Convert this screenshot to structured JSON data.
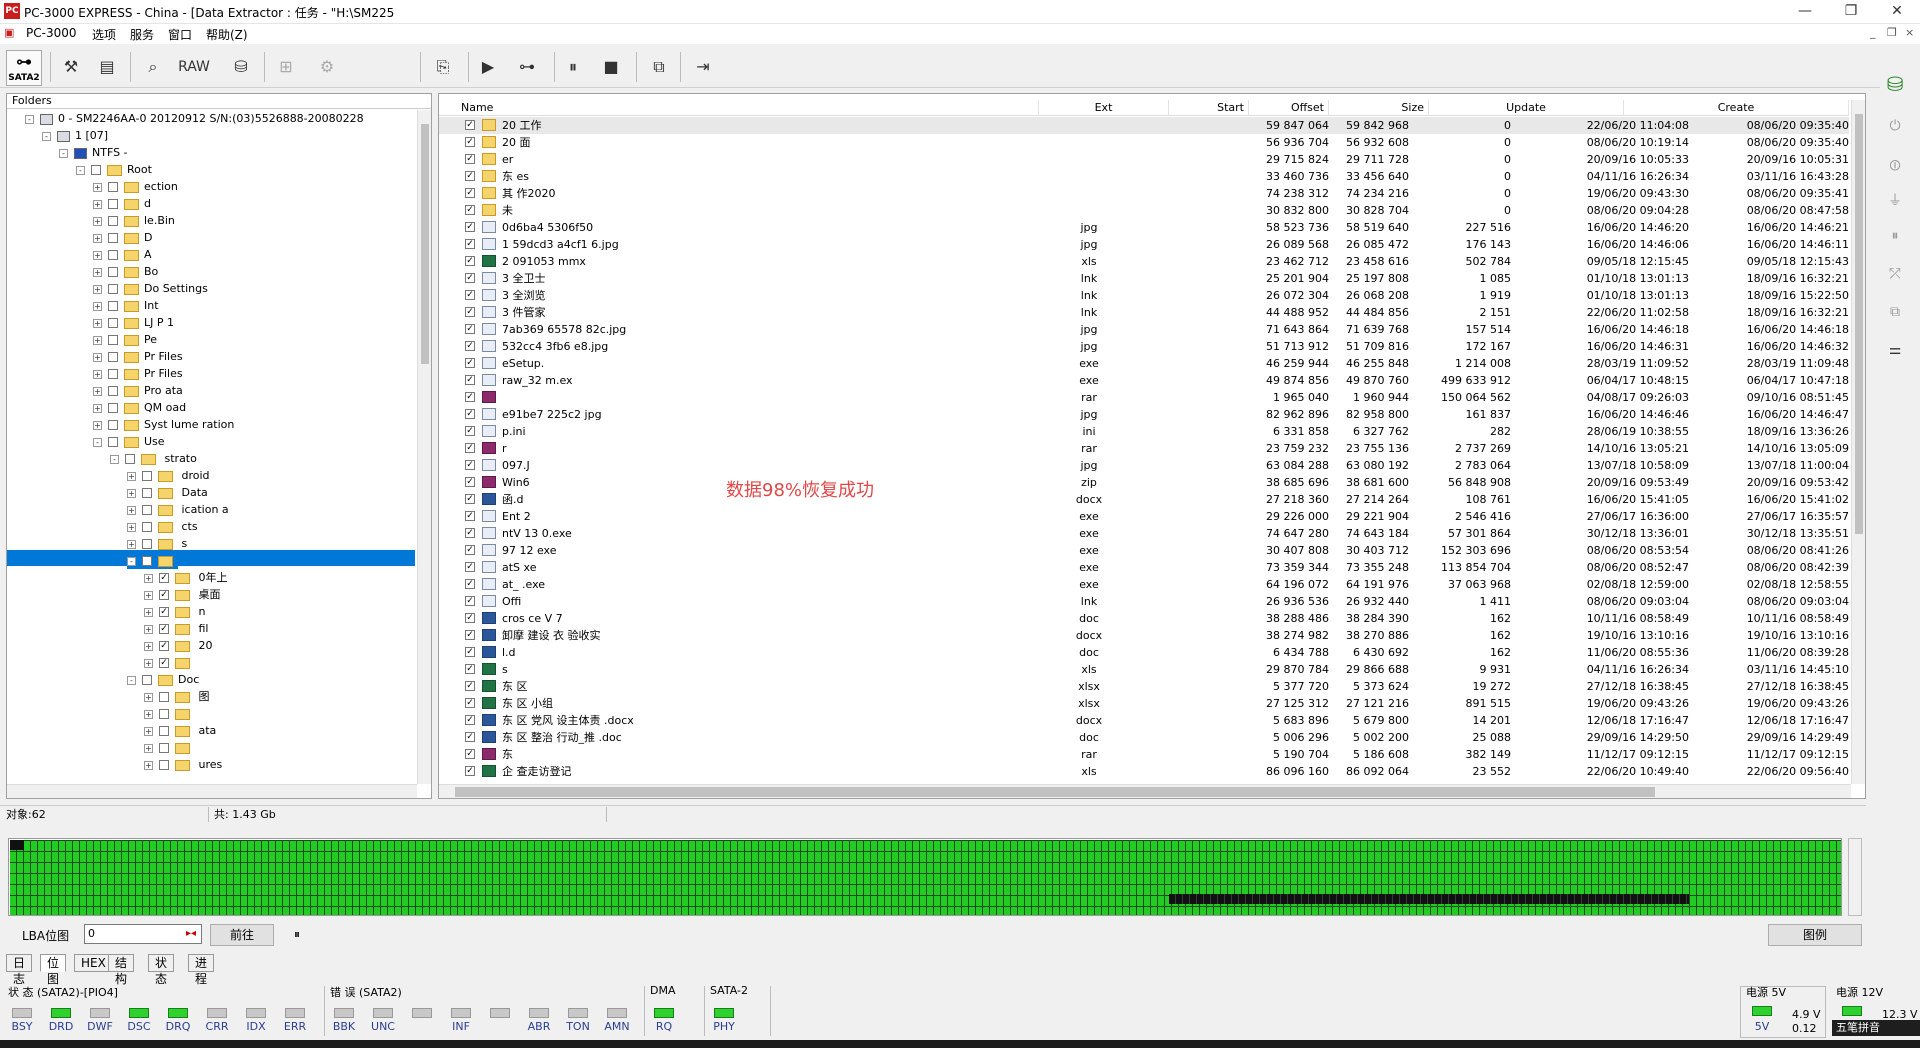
{
  "window": {
    "app_badge": "PC",
    "title": "PC-3000 EXPRESS - China - [Data Extractor : 任务 - \"H:\\SM225",
    "minimize": "—",
    "maximize": "❐",
    "close": "✕"
  },
  "menu": {
    "items": [
      "PC-3000",
      "选项",
      "服务",
      "窗口",
      "帮助(Z)"
    ],
    "mdi_min": "_",
    "mdi_restore": "❐",
    "mdi_close": "×"
  },
  "toolbar": {
    "sata_label": "SATA2",
    "sata_glyph": "⊶",
    "raw_label": "RAW",
    "tools_glyph": "⚒",
    "doc_glyph": "▤",
    "binoc_glyph": "⌕",
    "disk_glyph": "⛁",
    "grid_glyph": "⊞",
    "gears_glyph": "⚙",
    "export_glyph": "⎘",
    "play_glyph": "▶",
    "tree_glyph": "⊶",
    "pause_glyph": "⏸",
    "stop_glyph": "■",
    "copy_glyph": "⧉",
    "run_glyph": "⇥"
  },
  "tree": {
    "header": "Folders",
    "nodes": [
      {
        "label": "0 - SM2246AA-0 20120912 S/N:(03)5526888-20080228",
        "level": 0,
        "exp": "-",
        "check": ""
      },
      {
        "label": "1 [07]",
        "level": 1,
        "exp": "-",
        "check": ""
      },
      {
        "label": "NTFS -",
        "level": 2,
        "exp": "-",
        "check": ""
      },
      {
        "label": "Root",
        "level": 3,
        "exp": "-",
        "check": ""
      },
      {
        "label": "ection",
        "level": 4,
        "exp": "+",
        "check": ""
      },
      {
        "label": "d",
        "level": 4,
        "exp": "+",
        "check": ""
      },
      {
        "label": "le.Bin",
        "level": 4,
        "exp": "+",
        "check": ""
      },
      {
        "label": "D",
        "level": 4,
        "exp": "+",
        "check": ""
      },
      {
        "label": "A",
        "level": 4,
        "exp": "+",
        "check": ""
      },
      {
        "label": "Bo",
        "level": 4,
        "exp": "+",
        "check": ""
      },
      {
        "label": "Do          Settings",
        "level": 4,
        "exp": "+",
        "check": ""
      },
      {
        "label": "Int",
        "level": 4,
        "exp": "+",
        "check": ""
      },
      {
        "label": "LJ     P        1",
        "level": 4,
        "exp": "+",
        "check": ""
      },
      {
        "label": "Pe",
        "level": 4,
        "exp": "+",
        "check": ""
      },
      {
        "label": "Pr       Files",
        "level": 4,
        "exp": "+",
        "check": ""
      },
      {
        "label": "Pr       Files",
        "level": 4,
        "exp": "+",
        "check": ""
      },
      {
        "label": "Pro      ata",
        "level": 4,
        "exp": "+",
        "check": ""
      },
      {
        "label": "QM       oad",
        "level": 4,
        "exp": "+",
        "check": ""
      },
      {
        "label": "Syst     lume          ration",
        "level": 4,
        "exp": "+",
        "check": ""
      },
      {
        "label": "Use",
        "level": 4,
        "exp": "-",
        "check": ""
      },
      {
        "label": "           strato",
        "level": 5,
        "exp": "-",
        "check": ""
      },
      {
        "label": "     droid",
        "level": 6,
        "exp": "+",
        "check": ""
      },
      {
        "label": "     Data",
        "level": 6,
        "exp": "+",
        "check": ""
      },
      {
        "label": "     ication       a",
        "level": 6,
        "exp": "+",
        "check": ""
      },
      {
        "label": "     cts",
        "level": 6,
        "exp": "+",
        "check": ""
      },
      {
        "label": "     s",
        "level": 6,
        "exp": "+",
        "check": ""
      },
      {
        "label": "",
        "level": 6,
        "exp": "-",
        "check": "✓",
        "selected": true
      },
      {
        "label": "         0年上",
        "level": 7,
        "exp": "+",
        "check": "✓"
      },
      {
        "label": "          桌面",
        "level": 7,
        "exp": "+",
        "check": "✓"
      },
      {
        "label": "          n",
        "level": 7,
        "exp": "+",
        "check": "✓"
      },
      {
        "label": "          fil",
        "level": 7,
        "exp": "+",
        "check": "✓"
      },
      {
        "label": "                 20",
        "level": 7,
        "exp": "+",
        "check": "✓"
      },
      {
        "label": "",
        "level": 7,
        "exp": "+",
        "check": "✓"
      },
      {
        "label": "Doc",
        "level": 6,
        "exp": "-",
        "check": ""
      },
      {
        "label": "                  图",
        "level": 7,
        "exp": "+",
        "check": ""
      },
      {
        "label": "",
        "level": 7,
        "exp": "+",
        "check": ""
      },
      {
        "label": "                  ata",
        "level": 7,
        "exp": "+",
        "check": ""
      },
      {
        "label": "",
        "level": 7,
        "exp": "+",
        "check": ""
      },
      {
        "label": "               ures",
        "level": 7,
        "exp": "+",
        "check": ""
      }
    ]
  },
  "list": {
    "columns": [
      "Name",
      "Ext",
      "Start",
      "Offset",
      "Size",
      "Update",
      "Create"
    ],
    "rows": [
      {
        "icon": "folder",
        "name": "20       工作",
        "ext": "",
        "start": "59 847 064",
        "offset": "59 842 968",
        "size": "0",
        "update": "22/06/20 11:04:08",
        "create": "08/06/20 09:35:40"
      },
      {
        "icon": "folder",
        "name": "20       面",
        "ext": "",
        "start": "56 936 704",
        "offset": "56 932 608",
        "size": "0",
        "update": "08/06/20 10:19:14",
        "create": "08/06/20 09:35:40"
      },
      {
        "icon": "folder",
        "name": "er",
        "ext": "",
        "start": "29 715 824",
        "offset": "29 711 728",
        "size": "0",
        "update": "20/09/16 10:05:33",
        "create": "20/09/16 10:05:31"
      },
      {
        "icon": "folder",
        "name": "东      es",
        "ext": "",
        "start": "33 460 736",
        "offset": "33 456 640",
        "size": "0",
        "update": "04/11/16 16:26:34",
        "create": "03/11/16 16:43:28"
      },
      {
        "icon": "folder",
        "name": "其      作2020",
        "ext": "",
        "start": "74 238 312",
        "offset": "74 234 216",
        "size": "0",
        "update": "19/06/20 09:43:30",
        "create": "08/06/20 09:35:41"
      },
      {
        "icon": "folder",
        "name": "未",
        "ext": "",
        "start": "30 832 800",
        "offset": "30 828 704",
        "size": "0",
        "update": "08/06/20 09:04:28",
        "create": "08/06/20 08:47:58"
      },
      {
        "icon": "file",
        "name": "       0d6ba4          5306f50",
        "ext": "jpg",
        "start": "58 523 736",
        "offset": "58 519 640",
        "size": "227 516",
        "update": "16/06/20 14:46:20",
        "create": "16/06/20 14:46:21"
      },
      {
        "icon": "file",
        "name": "1      59dcd3       a4cf1         6.jpg",
        "ext": "jpg",
        "start": "26 089 568",
        "offset": "26 085 472",
        "size": "176 143",
        "update": "16/06/20 14:46:06",
        "create": "16/06/20 14:46:11"
      },
      {
        "icon": "xls",
        "name": "2      091053         mmx",
        "ext": "xls",
        "start": "23 462 712",
        "offset": "23 458 616",
        "size": "502 784",
        "update": "09/05/18 12:15:45",
        "create": "09/05/18 12:15:43"
      },
      {
        "icon": "file",
        "name": "3      全卫士",
        "ext": "lnk",
        "start": "25 201 904",
        "offset": "25 197 808",
        "size": "1 085",
        "update": "01/10/18 13:01:13",
        "create": "18/09/16 16:32:21"
      },
      {
        "icon": "file",
        "name": "3      全浏览",
        "ext": "lnk",
        "start": "26 072 304",
        "offset": "26 068 208",
        "size": "1 919",
        "update": "01/10/18 13:01:13",
        "create": "18/09/16 15:22:50"
      },
      {
        "icon": "file",
        "name": "3      件管家",
        "ext": "lnk",
        "start": "44 488 952",
        "offset": "44 484 856",
        "size": "2 151",
        "update": "22/06/20 11:02:58",
        "create": "18/09/16 16:32:21"
      },
      {
        "icon": "file",
        "name": "       7ab369          65578        82c.jpg",
        "ext": "jpg",
        "start": "71 643 864",
        "offset": "71 639 768",
        "size": "157 514",
        "update": "16/06/20 14:46:18",
        "create": "16/06/20 14:46:18"
      },
      {
        "icon": "file",
        "name": "       532cc4        3fb6       e8.jpg",
        "ext": "jpg",
        "start": "51 713 912",
        "offset": "51 709 816",
        "size": "172 167",
        "update": "16/06/20 14:46:31",
        "create": "16/06/20 14:46:32"
      },
      {
        "icon": "file",
        "name": "       eSetup.",
        "ext": "exe",
        "start": "46 259 944",
        "offset": "46 255 848",
        "size": "1 214 008",
        "update": "28/03/19 11:09:52",
        "create": "28/03/19 11:09:48"
      },
      {
        "icon": "file",
        "name": "       raw_32                m.ex",
        "ext": "exe",
        "start": "49 874 856",
        "offset": "49 870 760",
        "size": "499 633 912",
        "update": "06/04/17 10:48:15",
        "create": "06/04/17 10:47:18"
      },
      {
        "icon": "rar",
        "name": "",
        "ext": "rar",
        "start": "1 965 040",
        "offset": "1 960 944",
        "size": "150 064 562",
        "update": "04/08/17 09:26:03",
        "create": "09/10/16 08:51:45"
      },
      {
        "icon": "file",
        "name": "       e91be7            225c2          jpg",
        "ext": "jpg",
        "start": "82 962 896",
        "offset": "82 958 800",
        "size": "161 837",
        "update": "16/06/20 14:46:46",
        "create": "16/06/20 14:46:47"
      },
      {
        "icon": "file",
        "name": "       p.ini",
        "ext": "ini",
        "start": "6 331 858",
        "offset": "6 327 762",
        "size": "282",
        "update": "28/06/19 10:38:55",
        "create": "18/09/16 13:36:26"
      },
      {
        "icon": "rar",
        "name": "       r",
        "ext": "rar",
        "start": "23 759 232",
        "offset": "23 755 136",
        "size": "2 737 269",
        "update": "14/10/16 13:05:21",
        "create": "14/10/16 13:05:09"
      },
      {
        "icon": "file",
        "name": "       097.J",
        "ext": "jpg",
        "start": "63 084 288",
        "offset": "63 080 192",
        "size": "2 783 064",
        "update": "13/07/18 10:58:09",
        "create": "13/07/18 11:00:04"
      },
      {
        "icon": "rar",
        "name": "       Win6",
        "ext": "zip",
        "start": "38 685 696",
        "offset": "38 681 600",
        "size": "56 848 908",
        "update": "20/09/16 09:53:49",
        "create": "20/09/16 09:53:42"
      },
      {
        "icon": "doc",
        "name": "       函.d",
        "ext": "docx",
        "start": "27 218 360",
        "offset": "27 214 264",
        "size": "108 761",
        "update": "16/06/20 15:41:05",
        "create": "16/06/20 15:41:02"
      },
      {
        "icon": "file",
        "name": "       Ent    2",
        "ext": "exe",
        "start": "29 226 000",
        "offset": "29 221 904",
        "size": "2 546 416",
        "update": "27/06/17 16:36:00",
        "create": "27/06/17 16:35:57"
      },
      {
        "icon": "file",
        "name": "       ntV       13        0.exe",
        "ext": "exe",
        "start": "74 647 280",
        "offset": "74 643 184",
        "size": "57 301 864",
        "update": "30/12/18 13:36:01",
        "create": "30/12/18 13:35:51"
      },
      {
        "icon": "file",
        "name": "       97     12       exe",
        "ext": "exe",
        "start": "30 407 808",
        "offset": "30 403 712",
        "size": "152 303 696",
        "update": "08/06/20 08:53:54",
        "create": "08/06/20 08:41:26"
      },
      {
        "icon": "file",
        "name": "       atS      xe",
        "ext": "exe",
        "start": "73 359 344",
        "offset": "73 355 248",
        "size": "113 854 704",
        "update": "08/06/20 08:52:47",
        "create": "08/06/20 08:42:39"
      },
      {
        "icon": "file",
        "name": "       at_       .exe",
        "ext": "exe",
        "start": "64 196 072",
        "offset": "64 191 976",
        "size": "37 063 968",
        "update": "02/08/18 12:59:00",
        "create": "02/08/18 12:58:55"
      },
      {
        "icon": "file",
        "name": "       Offi",
        "ext": "lnk",
        "start": "26 936 536",
        "offset": "26 932 440",
        "size": "1 411",
        "update": "08/06/20 09:03:04",
        "create": "08/06/20 09:03:04"
      },
      {
        "icon": "doc",
        "name": "       cros      ce V      7",
        "ext": "doc",
        "start": "38 288 486",
        "offset": "38 284 390",
        "size": "162",
        "update": "10/11/16 08:58:49",
        "create": "10/11/16 08:58:49"
      },
      {
        "icon": "doc",
        "name": "       卸摩      建设       衣      验收实",
        "ext": "docx",
        "start": "38 274 982",
        "offset": "38 270 886",
        "size": "162",
        "update": "19/10/16 13:10:16",
        "create": "19/10/16 13:10:16"
      },
      {
        "icon": "doc",
        "name": "       l.d",
        "ext": "doc",
        "start": "6 434 788",
        "offset": "6 430 692",
        "size": "162",
        "update": "11/06/20 08:55:36",
        "create": "11/06/20 08:39:28"
      },
      {
        "icon": "xls",
        "name": "       s",
        "ext": "xls",
        "start": "29 870 784",
        "offset": "29 866 688",
        "size": "9 931",
        "update": "04/11/16 16:26:34",
        "create": "03/11/16 14:45:10"
      },
      {
        "icon": "xls",
        "name": "东    区",
        "ext": "xlsx",
        "start": "5 377 720",
        "offset": "5 373 624",
        "size": "19 272",
        "update": "27/12/18 16:38:45",
        "create": "27/12/18 16:38:45"
      },
      {
        "icon": "xls",
        "name": "东    区      小组",
        "ext": "xlsx",
        "start": "27 125 312",
        "offset": "27 121 216",
        "size": "891 515",
        "update": "19/06/20 09:43:26",
        "create": "19/06/20 09:43:26"
      },
      {
        "icon": "doc",
        "name": "东    区      党风      设主体责          .docx",
        "ext": "docx",
        "start": "5 683 896",
        "offset": "5 679 800",
        "size": "14 201",
        "update": "12/06/18 17:16:47",
        "create": "12/06/18 17:16:47"
      },
      {
        "icon": "doc",
        "name": "东    区    整治        行动_推          .doc",
        "ext": "doc",
        "start": "5 006 296",
        "offset": "5 002 200",
        "size": "25 088",
        "update": "29/09/16 14:29:50",
        "create": "29/09/16 14:29:49"
      },
      {
        "icon": "rar",
        "name": "东",
        "ext": "rar",
        "start": "5 190 704",
        "offset": "5 186 608",
        "size": "382 149",
        "update": "11/12/17 09:12:15",
        "create": "11/12/17 09:12:15"
      },
      {
        "icon": "xls",
        "name": "企      查走访登记",
        "ext": "xls",
        "start": "86 096 160",
        "offset": "86 092 064",
        "size": "23 552",
        "update": "22/06/20 10:49:40",
        "create": "22/06/20 09:56:40"
      }
    ]
  },
  "overlay_text": "数据98%恢复成功",
  "status": {
    "objects": "对象:62",
    "total": "共:  1.43 Gb"
  },
  "lba": {
    "label": "LBA位图",
    "value": "0",
    "go_button": "前往",
    "pause": "⏸",
    "legend_button": "图例"
  },
  "tabs": [
    "日志",
    "位图",
    "HEX",
    "结构",
    "状态",
    "进程"
  ],
  "active_tab": 1,
  "leds": {
    "state_label": "状 态 (SATA2)-[PIO4]",
    "state": [
      {
        "name": "BSY",
        "on": false
      },
      {
        "name": "DRD",
        "on": true
      },
      {
        "name": "DWF",
        "on": false
      },
      {
        "name": "DSC",
        "on": true
      },
      {
        "name": "DRQ",
        "on": true
      },
      {
        "name": "CRR",
        "on": false
      },
      {
        "name": "IDX",
        "on": false
      },
      {
        "name": "ERR",
        "on": false
      }
    ],
    "error_label": "错 误 (SATA2)",
    "error": [
      {
        "name": "BBK",
        "on": false
      },
      {
        "name": "UNC",
        "on": false
      },
      {
        "name": "",
        "on": false
      },
      {
        "name": "INF",
        "on": false
      },
      {
        "name": "",
        "on": false
      },
      {
        "name": "ABR",
        "on": false
      },
      {
        "name": "TON",
        "on": false
      },
      {
        "name": "AMN",
        "on": false
      }
    ],
    "dma_label": "DMA",
    "dma": [
      {
        "name": "RQ",
        "on": true
      }
    ],
    "sata_label": "SATA-2",
    "sata": [
      {
        "name": "PHY",
        "on": true
      }
    ]
  },
  "power": {
    "p5_label": "电源 5V",
    "p5_led": "5V",
    "p5_v": "4.9 V",
    "p5_a": "0.12",
    "p12_label": "电源 12V",
    "p12_v": "12.3 V",
    "ime": "五笔拼音"
  },
  "colors": {
    "selection": "#0078d7",
    "led_on": "#2ed12e",
    "overlay": "#e04848",
    "folder": "#f6d46c"
  }
}
